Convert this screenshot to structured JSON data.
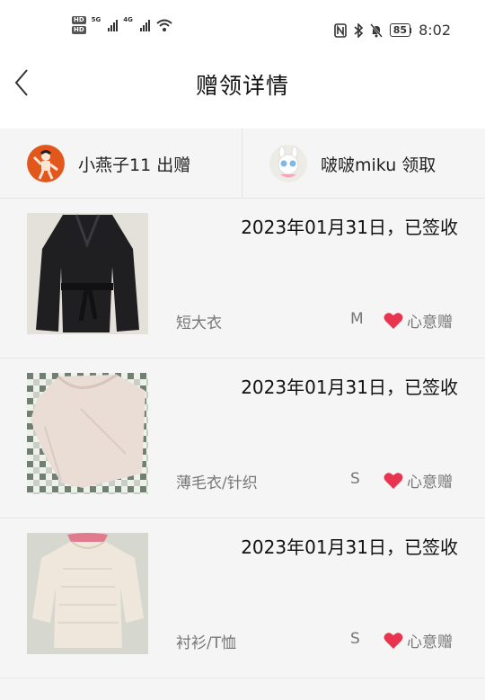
{
  "status_bar": {
    "hd1": "HD",
    "hd2": "HD",
    "net1": "5G",
    "net2": "4G",
    "battery": "85",
    "time": "8:02"
  },
  "header": {
    "title": "赠领详情"
  },
  "people": {
    "giver": "小燕子11 出赠",
    "receiver": "啵啵miku 领取"
  },
  "items": [
    {
      "date": "2023年01月31日，已签收",
      "category": "短大衣",
      "size": "M",
      "tag": "心意赠"
    },
    {
      "date": "2023年01月31日，已签收",
      "category": "薄毛衣/针织",
      "size": "S",
      "tag": "心意赠"
    },
    {
      "date": "2023年01月31日，已签收",
      "category": "衬衫/T恤",
      "size": "S",
      "tag": "心意赠"
    }
  ],
  "colors": {
    "heart": "#e8344e",
    "background": "#f5f5f5",
    "header_bg": "#ffffff"
  },
  "icons": [
    "back-arrow-icon",
    "heart-icon",
    "nfc-icon",
    "bluetooth-icon",
    "bell-off-icon",
    "wifi-icon",
    "battery-icon"
  ]
}
